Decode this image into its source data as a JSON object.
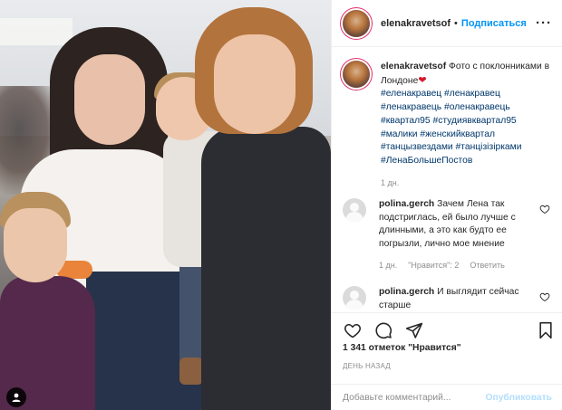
{
  "post": {
    "image": {
      "alt": ""
    }
  },
  "header": {
    "username": "elenakravetsof",
    "separator": "•",
    "follow_label": "Подписаться",
    "more_label": "···"
  },
  "caption": {
    "username": "elenakravetsof",
    "text": "Фото с поклонниками в Лондоне",
    "emoji": "❤",
    "tags": "#еленакравец #ленакравец #ленакравець #оленакравець #квартал95 #студиявквартал95 #малики #женскийквартал #танцызвездами #танцізізірками #ЛенаБольшеПостов",
    "time": "1 дн."
  },
  "comments": [
    {
      "username": "polina.gerch",
      "text": "Зачем Лена так подстриглась, ей было лучше с длинными, а это как будто ее погрызли, лично мое мнение",
      "time": "1 дн.",
      "likes": "\"Нравится\": 2",
      "reply": "Ответить"
    },
    {
      "username": "polina.gerch",
      "text": "И выглядит сейчас старше"
    }
  ],
  "actions": {
    "likes": "1 341 отметок \"Нравится\"",
    "date": "ДЕНЬ НАЗАД"
  },
  "add_comment": {
    "placeholder": "Добавьте комментарий...",
    "publish": "Опубликовать"
  },
  "colors": {
    "follow": "#0095f6",
    "hashtag": "#00376b",
    "muted": "#8e8e8e",
    "publish_disabled": "#b2dffc",
    "heart": "#d5182f"
  }
}
